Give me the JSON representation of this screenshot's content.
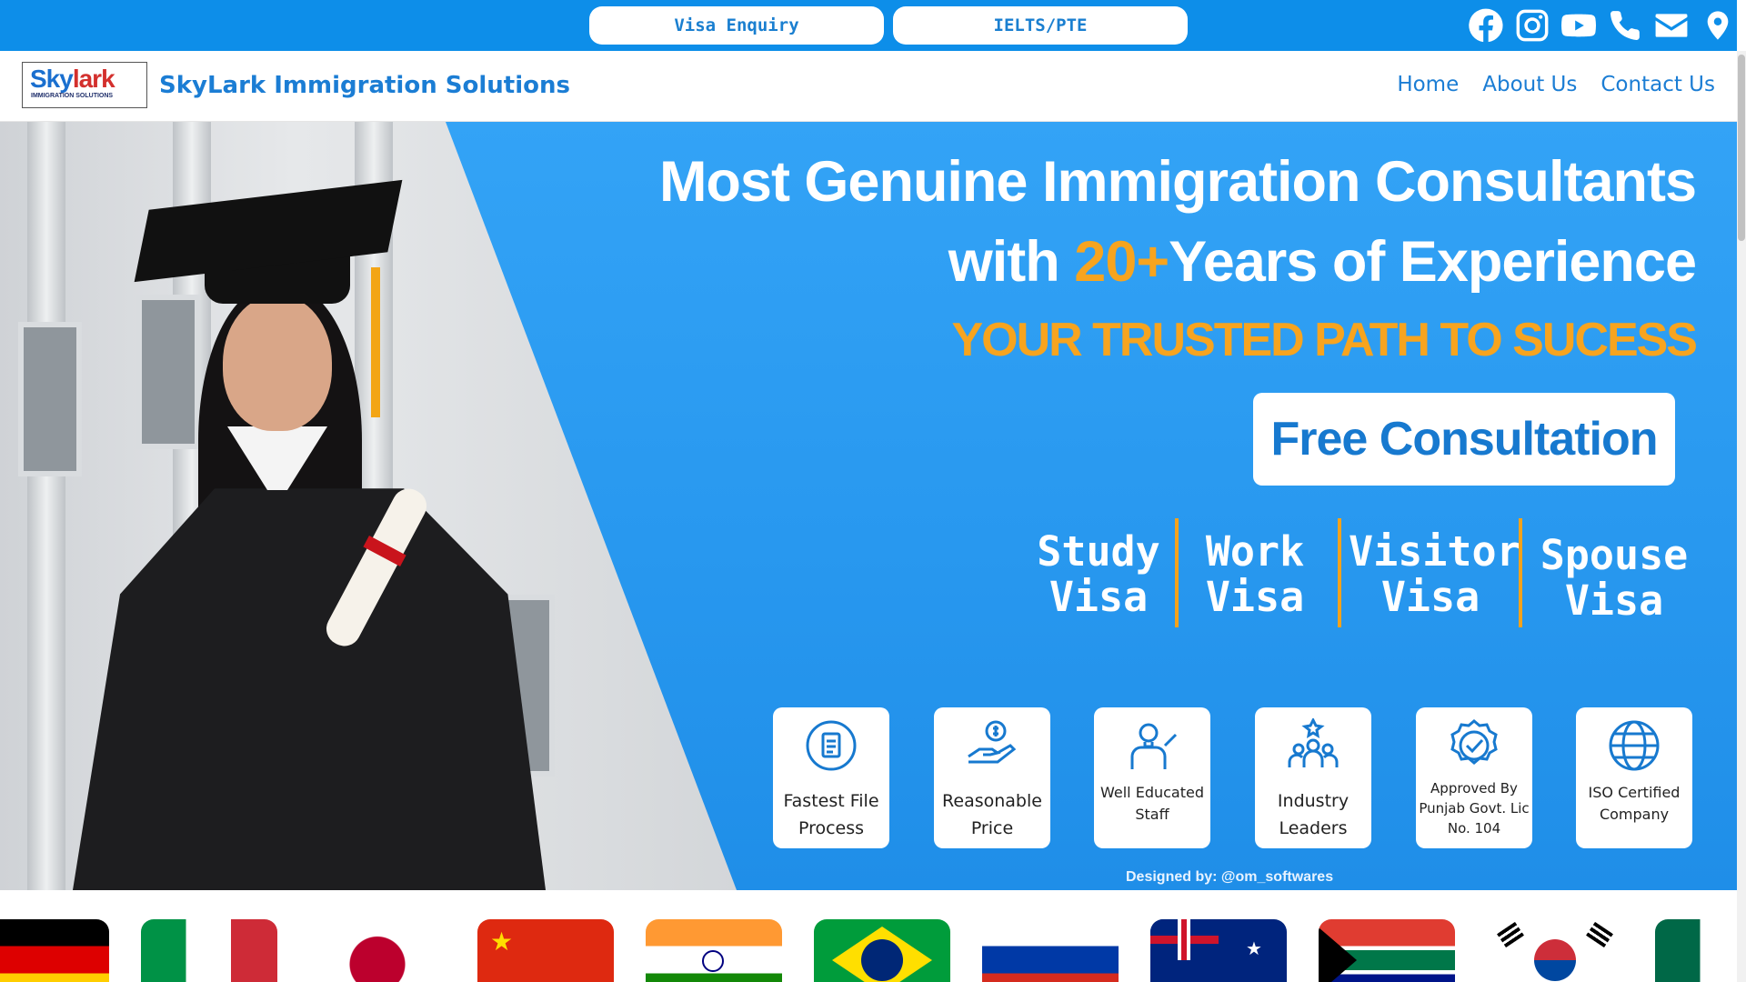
{
  "topbar": {
    "visa_enquiry": "Visa Enquiry",
    "ielts_pte": "IELTS/PTE",
    "social_icons": [
      "facebook-icon",
      "instagram-icon",
      "youtube-icon",
      "phone-icon",
      "mail-icon",
      "location-pin-icon"
    ]
  },
  "header": {
    "logo_sky": "Sky",
    "logo_lark": "lark",
    "logo_sub": "IMMIGRATION SOLUTIONS",
    "brand": "SkyLark Immigration Solutions",
    "nav": [
      "Home",
      "About Us",
      "Contact Us"
    ]
  },
  "hero": {
    "line1": "Most Genuine Immigration Consultants",
    "line2_prefix": "with ",
    "line2_highlight": "20+",
    "line2_suffix": "Years of Experience",
    "tagline": "YOUR TRUSTED PATH TO SUCESS",
    "cta": "Free Consultation",
    "visa_types": [
      {
        "line1": "Study",
        "line2": "Visa"
      },
      {
        "line1": "Work",
        "line2": "Visa"
      },
      {
        "line1": "Visitor",
        "line2": "Visa"
      },
      {
        "line1": "Spouse",
        "line2": "Visa"
      }
    ],
    "features": [
      {
        "icon": "file-process-icon",
        "label": "Fastest File Process"
      },
      {
        "icon": "price-hand-icon",
        "label": "Reasonable Price"
      },
      {
        "icon": "educated-staff-icon",
        "label": "Well Educated Staff"
      },
      {
        "icon": "industry-leaders-icon",
        "label": "Industry Leaders"
      },
      {
        "icon": "approved-badge-icon",
        "label": "Approved By Punjab Govt. Lic No. 104"
      },
      {
        "icon": "iso-globe-icon",
        "label": "ISO Certified Company"
      }
    ],
    "credit": "Designed by: @om_softwares"
  },
  "colors": {
    "brand_blue": "#0d8ee9",
    "accent_orange": "#f7a41f",
    "text_blue": "#1b7dd4"
  },
  "flags": [
    "germany-flag",
    "italy-flag",
    "japan-flag",
    "china-flag",
    "india-flag",
    "brazil-flag",
    "russia-flag",
    "australia-flag",
    "south-africa-flag",
    "south-korea-flag",
    "mexico-flag"
  ]
}
